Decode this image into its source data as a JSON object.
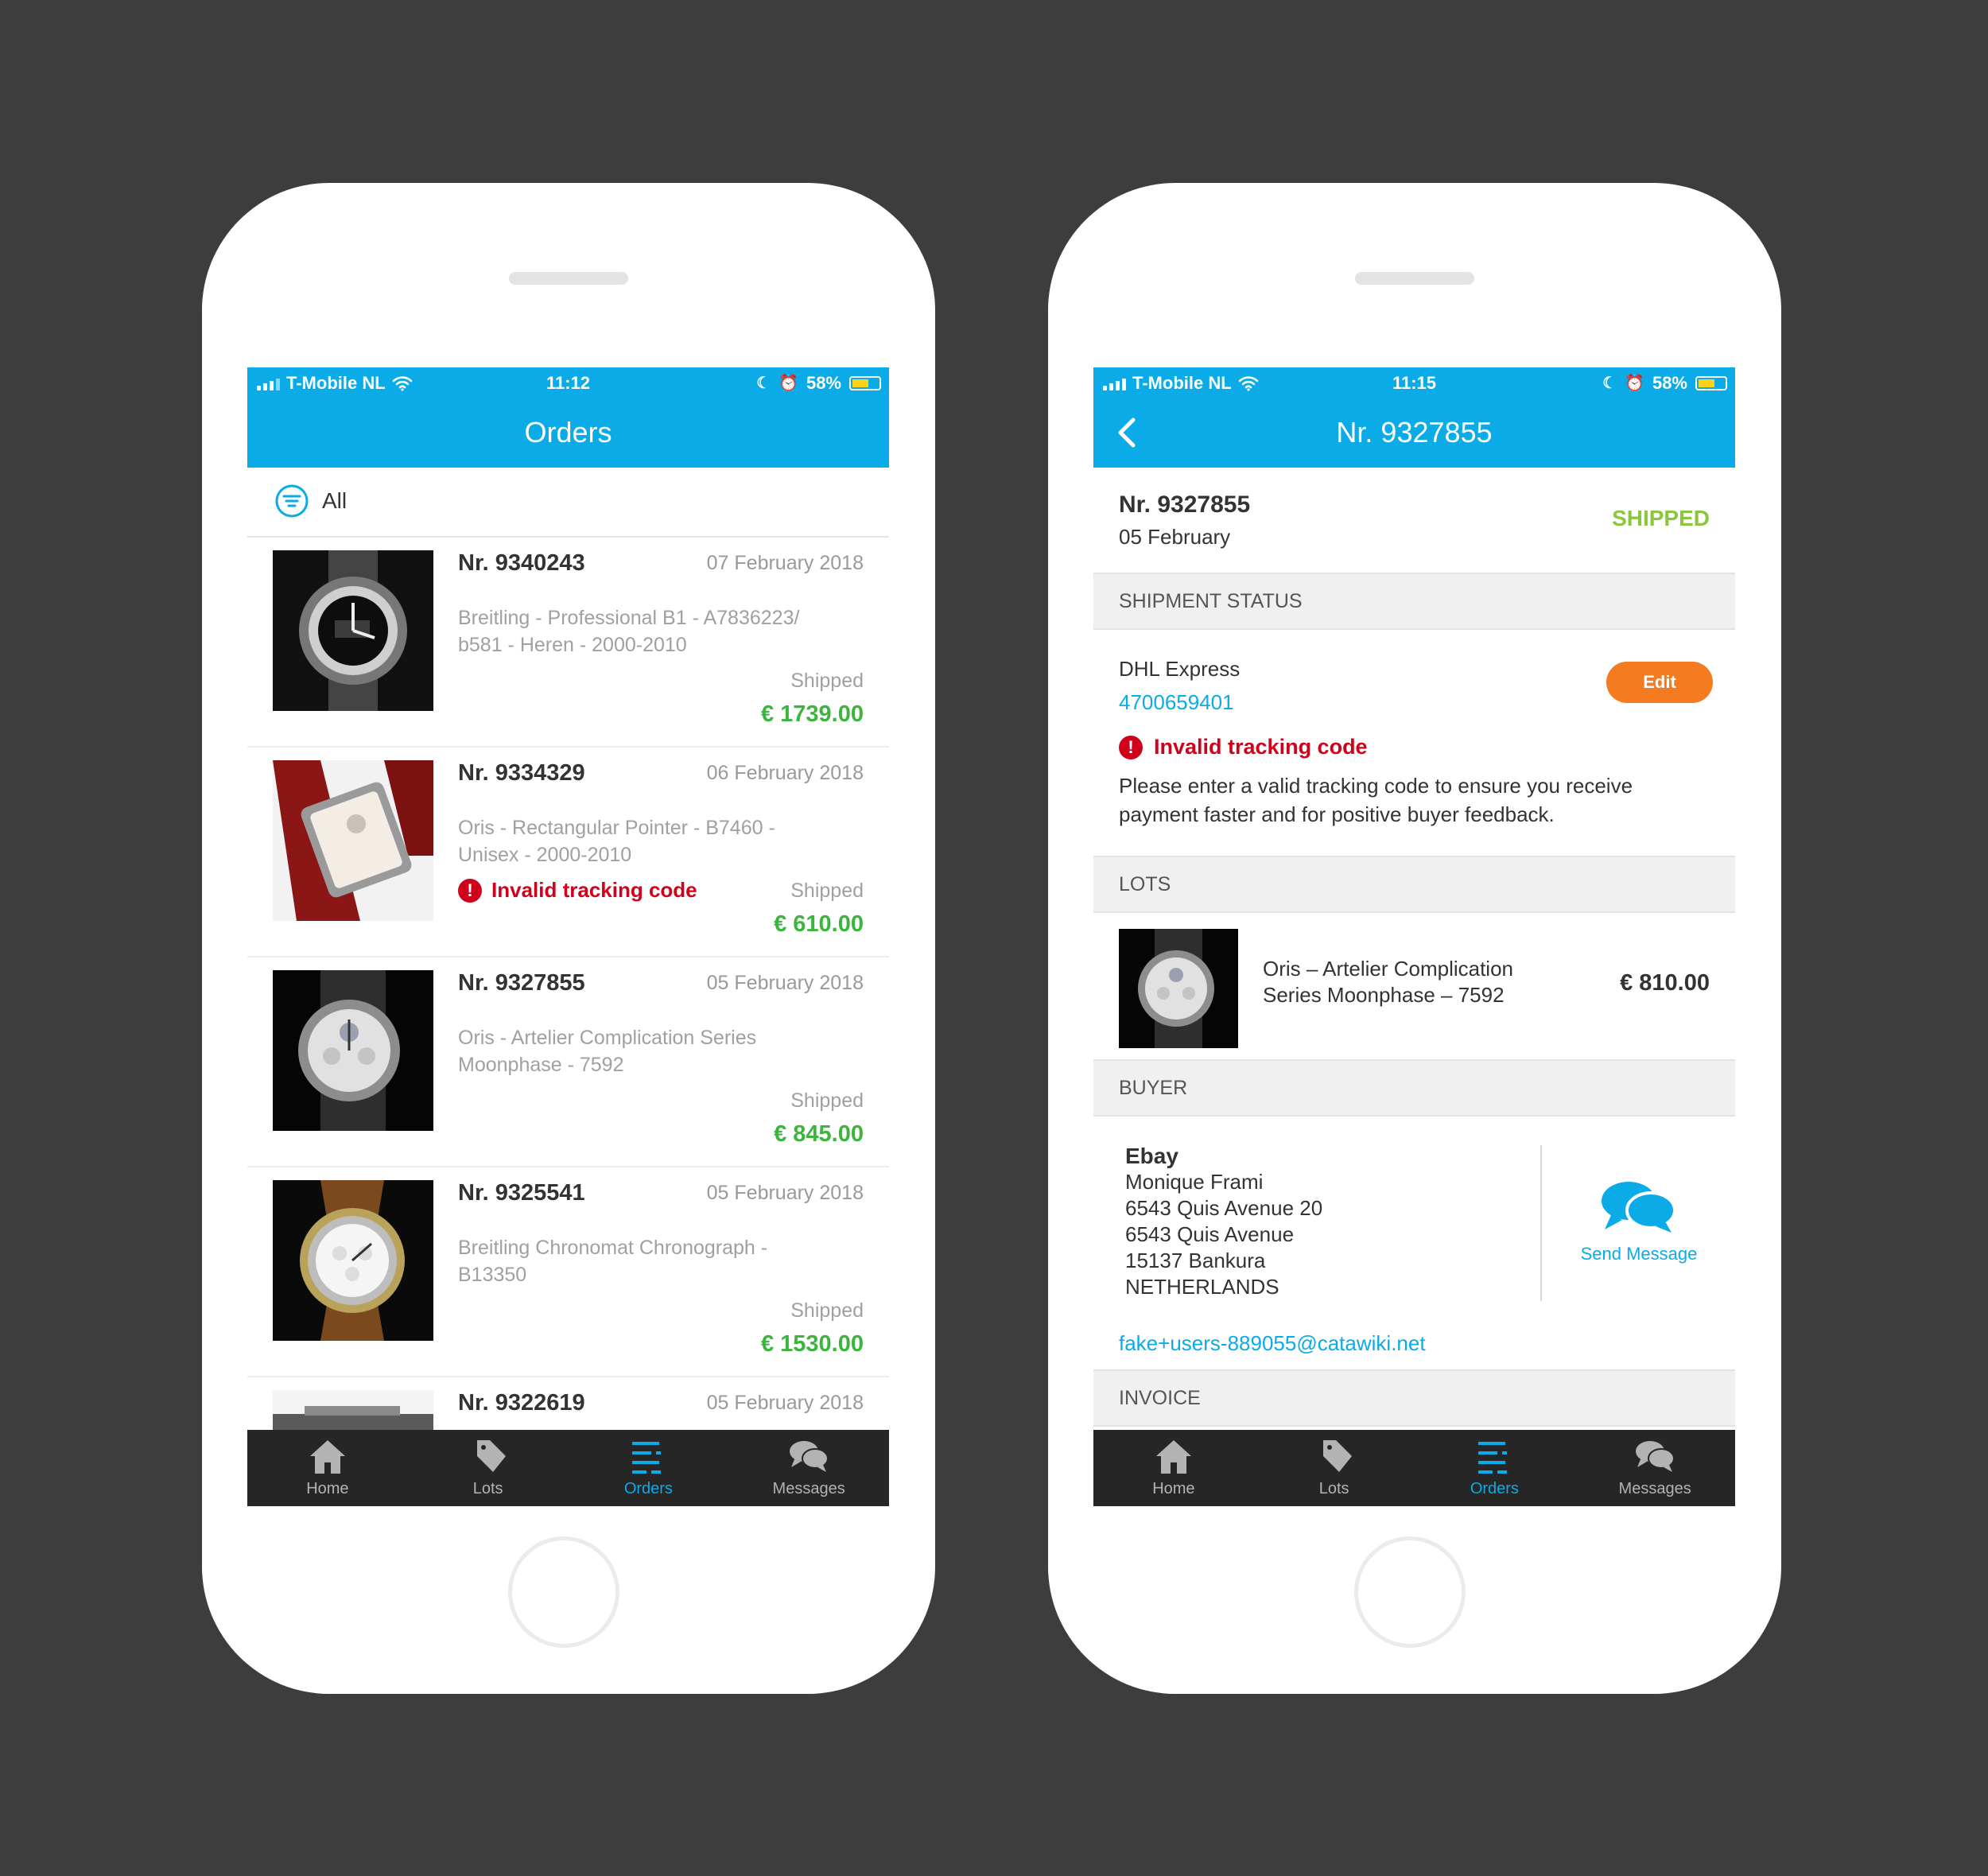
{
  "status_left": {
    "carrier": "T-Mobile NL",
    "time": "11:12",
    "battery": "58%"
  },
  "status_right": {
    "carrier": "T-Mobile NL",
    "time": "11:15",
    "battery": "58%"
  },
  "orders_screen": {
    "title": "Orders",
    "filter_label": "All",
    "orders": [
      {
        "nr": "Nr. 9340243",
        "date": "07 February 2018",
        "desc": "Breitling - Professional B1 - A7836223/ b581 - Heren - 2000-2010",
        "state": "Shipped",
        "price": "€ 1739.00"
      },
      {
        "nr": "Nr. 9334329",
        "date": "06 February 2018",
        "desc": "Oris - Rectangular Pointer - B7460 - Unisex - 2000-2010",
        "warning": "Invalid tracking code",
        "state": "Shipped",
        "price": "€ 610.00"
      },
      {
        "nr": "Nr. 9327855",
        "date": "05 February 2018",
        "desc": "Oris - Artelier Complication Series Moonphase - 7592",
        "state": "Shipped",
        "price": "€ 845.00"
      },
      {
        "nr": "Nr. 9325541",
        "date": "05 February 2018",
        "desc": "Breitling Chronomat Chronograph - B13350",
        "state": "Shipped",
        "price": "€ 1530.00"
      },
      {
        "nr": "Nr. 9322619",
        "date": "05 February 2018"
      }
    ]
  },
  "detail_screen": {
    "title": "Nr. 9327855",
    "order_nr": "Nr. 9327855",
    "order_date": "05 February",
    "status": "SHIPPED",
    "shipment_header": "SHIPMENT STATUS",
    "carrier": "DHL Express",
    "tracking": "4700659401",
    "edit_label": "Edit",
    "warning": "Invalid tracking code",
    "note": "Please enter a valid tracking code to ensure you receive payment faster and for positive buyer feedback.",
    "lots_header": "LOTS",
    "lot_title": "Oris – Artelier Complication Series Moonphase – 7592",
    "lot_price": "€ 810.00",
    "buyer_header": "BUYER",
    "buyer": {
      "name": "Ebay",
      "line1": "Monique Frami",
      "line2": "6543 Quis Avenue 20",
      "line3": "6543 Quis Avenue",
      "line4": "15137 Bankura",
      "line5": "NETHERLANDS"
    },
    "send_message": "Send Message",
    "email": "fake+users-889055@catawiki.net",
    "invoice_header": "INVOICE"
  },
  "tabs": {
    "home": "Home",
    "lots": "Lots",
    "orders": "Orders",
    "messages": "Messages"
  },
  "colors": {
    "accent": "#0aabe6",
    "price_green": "#3bb53b",
    "shipped_green": "#8cc63f",
    "error_red": "#d0021b",
    "edit_orange": "#f47b20",
    "tabbar": "#262626"
  }
}
